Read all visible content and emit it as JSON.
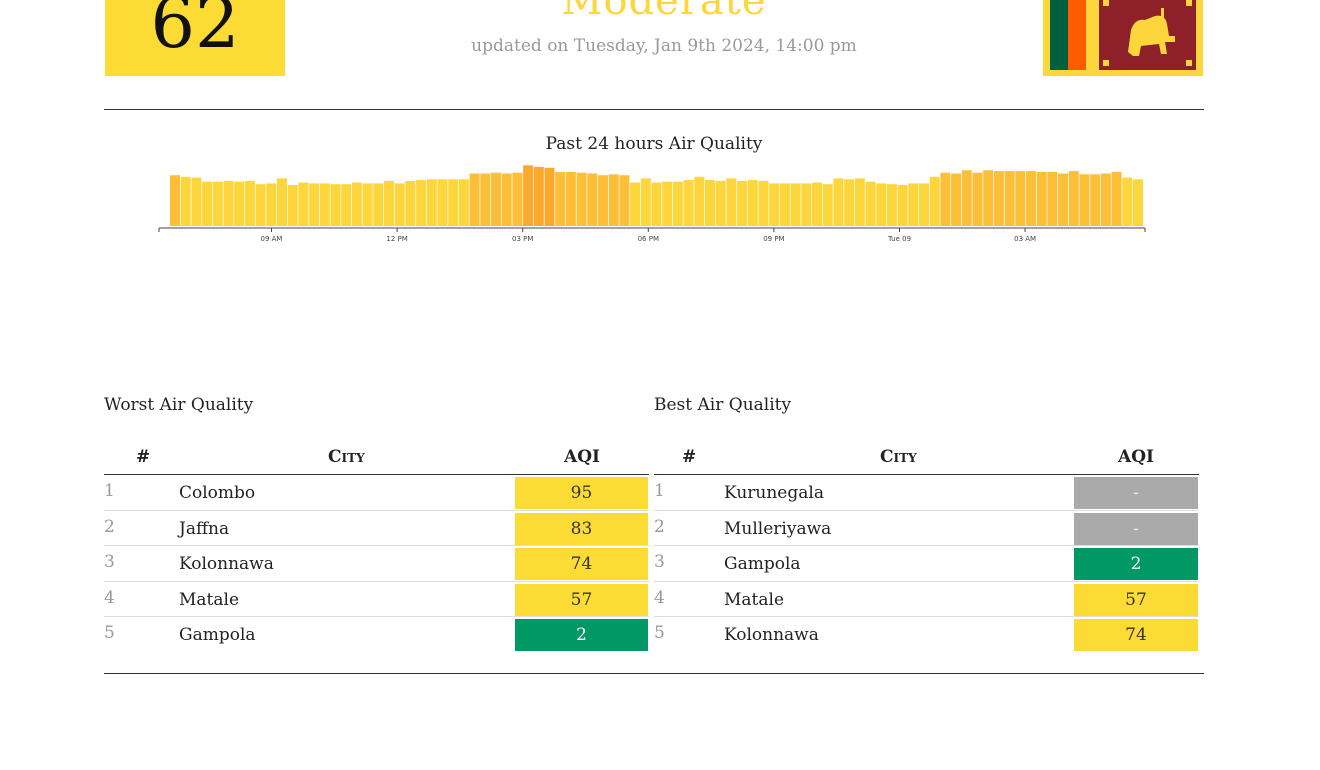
{
  "summary": {
    "aqi": "62",
    "status": "Moderate",
    "updated": "updated on Tuesday, Jan 9th 2024, 14:00 pm",
    "aqi_color": "#fcdc34"
  },
  "flag": {
    "icon": "sri-lanka-flag-icon"
  },
  "chart_data": {
    "type": "bar",
    "title": "Past 24 hours Air Quality",
    "xlabel": "",
    "ylabel": "",
    "tick_labels": [
      "09 AM",
      "12 PM",
      "03 PM",
      "06 PM",
      "09 PM",
      "Tue 09",
      "03 AM"
    ],
    "ylim": [
      0,
      100
    ],
    "grid": false,
    "values": [
      62,
      60,
      59,
      54,
      54,
      55,
      54,
      55,
      51,
      52,
      58,
      50,
      53,
      52,
      52,
      51,
      51,
      53,
      52,
      52,
      55,
      52,
      55,
      56,
      57,
      57,
      57,
      57,
      64,
      64,
      65,
      64,
      65,
      74,
      72,
      71,
      66,
      66,
      65,
      64,
      62,
      63,
      62,
      53,
      58,
      53,
      54,
      54,
      56,
      60,
      56,
      55,
      58,
      55,
      56,
      55,
      52,
      52,
      52,
      52,
      53,
      51,
      58,
      57,
      58,
      54,
      52,
      51,
      50,
      52,
      52,
      60,
      65,
      64,
      68,
      65,
      68,
      67,
      67,
      67,
      67,
      66,
      66,
      64,
      67,
      63,
      63,
      64,
      66,
      59,
      57
    ],
    "colors": {
      "moderate": "#fcd63b",
      "moderate_high": "#fdbf38",
      "high": "#fba82d"
    }
  },
  "worst": {
    "title": "Worst Air Quality",
    "headers": {
      "rank": "#",
      "city": "City",
      "aqi": "AQI"
    },
    "rows": [
      {
        "rank": "1",
        "city": "Colombo",
        "aqi": "95",
        "color": "#fcdc34"
      },
      {
        "rank": "2",
        "city": "Jaffna",
        "aqi": "83",
        "color": "#fcdc34"
      },
      {
        "rank": "3",
        "city": "Kolonnawa",
        "aqi": "74",
        "color": "#fcdc34"
      },
      {
        "rank": "4",
        "city": "Matale",
        "aqi": "57",
        "color": "#fcdc34"
      },
      {
        "rank": "5",
        "city": "Gampola",
        "aqi": "2",
        "color": "#009865"
      }
    ]
  },
  "best": {
    "title": "Best Air Quality",
    "headers": {
      "rank": "#",
      "city": "City",
      "aqi": "AQI"
    },
    "rows": [
      {
        "rank": "1",
        "city": "Kurunegala",
        "aqi": "-",
        "color": "#aaaaaa"
      },
      {
        "rank": "2",
        "city": "Mulleriyawa",
        "aqi": "-",
        "color": "#aaaaaa"
      },
      {
        "rank": "3",
        "city": "Gampola",
        "aqi": "2",
        "color": "#009865"
      },
      {
        "rank": "4",
        "city": "Matale",
        "aqi": "57",
        "color": "#fcdc34"
      },
      {
        "rank": "5",
        "city": "Kolonnawa",
        "aqi": "74",
        "color": "#fcdc34"
      }
    ]
  }
}
